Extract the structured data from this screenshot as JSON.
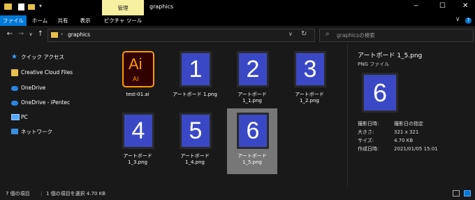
{
  "window": {
    "title": "graphics",
    "context_tab": "管理",
    "controls": [
      "─",
      "☐",
      "✕"
    ]
  },
  "ribbon": {
    "tabs": [
      "ファイル",
      "ホーム",
      "共有",
      "表示",
      "ピクチャ ツール"
    ]
  },
  "address": {
    "path": "graphics",
    "search_placeholder": "graphicsの検索"
  },
  "sidebar": {
    "items": [
      {
        "label": "クイック アクセス",
        "icon": "star-icon"
      },
      {
        "label": "Creative Cloud Files",
        "icon": "creative-cloud-folder-icon"
      },
      {
        "label": "OneDrive",
        "icon": "cloud-icon"
      },
      {
        "label": "OneDrive - iPentec",
        "icon": "cloud-icon"
      },
      {
        "label": "PC",
        "icon": "pc-icon"
      },
      {
        "label": "ネットワーク",
        "icon": "network-icon"
      }
    ]
  },
  "files": [
    {
      "name": "test-01.ai",
      "thumb": "Ai",
      "sub": "AI"
    },
    {
      "name": "アートボード 1.png",
      "thumb": "1"
    },
    {
      "name": "アートボード 1_1.png",
      "thumb": "2"
    },
    {
      "name": "アートボード 1_2.png",
      "thumb": "3"
    },
    {
      "name": "アートボード 1_3.png",
      "thumb": "4"
    },
    {
      "name": "アートボード 1_4.png",
      "thumb": "5"
    },
    {
      "name": "アートボード 1_5.png",
      "thumb": "6"
    }
  ],
  "preview": {
    "title": "アートボード 1_5.png",
    "type": "PNG ファイル",
    "thumb": "6",
    "props": [
      {
        "k": "撮影日時:",
        "v": "撮影日の指定"
      },
      {
        "k": "大きさ:",
        "v": "321 x 321"
      },
      {
        "k": "サイズ:",
        "v": "4.70 KB"
      },
      {
        "k": "作成日時:",
        "v": "2021/01/05 15:01"
      }
    ]
  },
  "status": {
    "count": "7 個の項目",
    "selection": "1 個の項目を選択  4.70 KB"
  },
  "colors": {
    "accent": "#0078d7",
    "tile_blue": "#3a48c6",
    "ai_orange": "#ff9a00",
    "ai_bg": "#330000",
    "context_tab": "#f7f0a0"
  }
}
